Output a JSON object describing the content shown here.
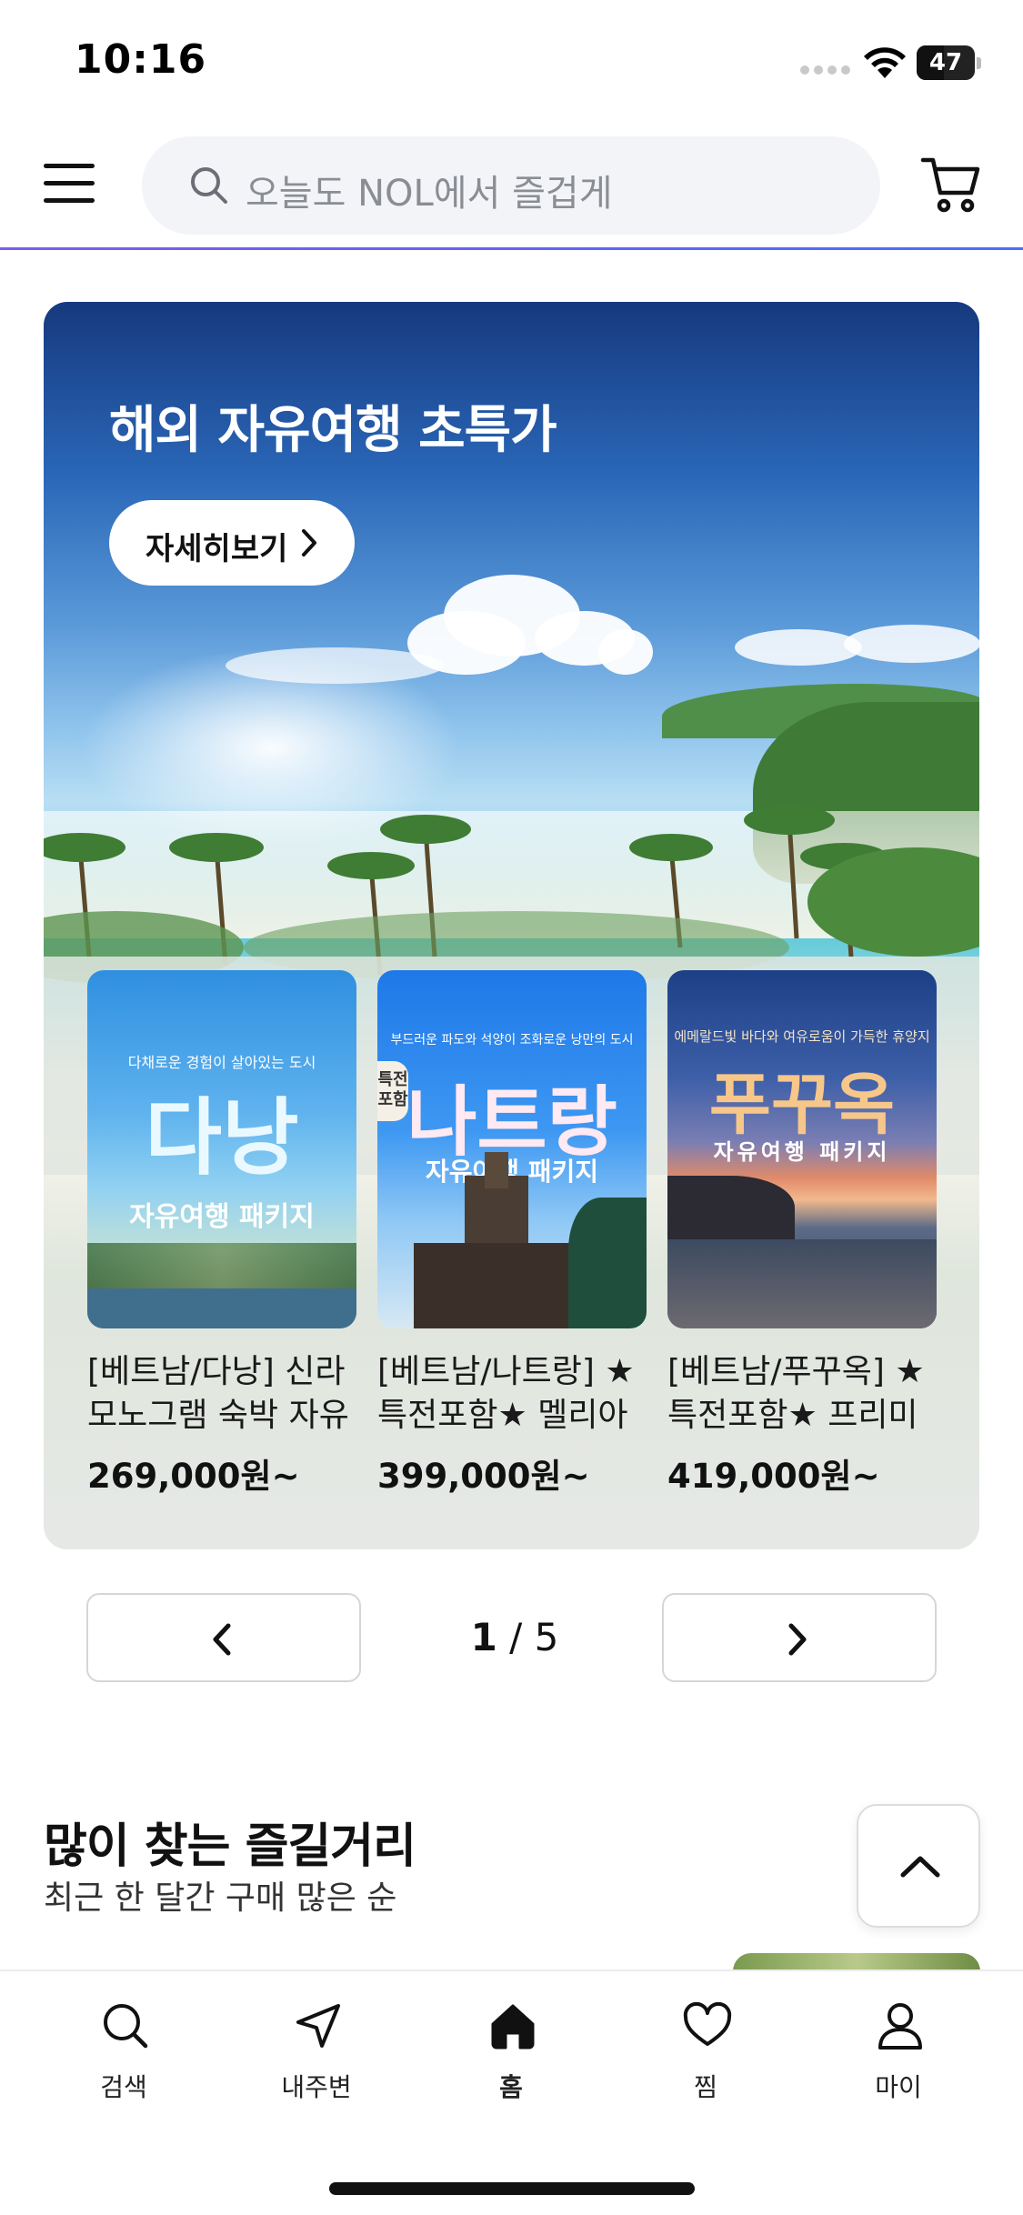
{
  "status_bar": {
    "time": "10:16",
    "battery": "47",
    "battery_percent": 47
  },
  "header": {
    "search_placeholder": "오늘도 NOL에서 즐겁게",
    "accent_color": "#6a5cf3"
  },
  "promo": {
    "title": "해외 자유여행 초특가",
    "detail_button": "자세히보기",
    "products": [
      {
        "image_city": "다낭",
        "image_tagline": "다채로운 경험이 살아있는 도시",
        "image_package": "자유여행 패키지",
        "name": "[베트남/다낭] 신라 모노그램 숙박 자유",
        "price": "269,000원~"
      },
      {
        "image_city": "나트랑",
        "image_tagline": "부드러운 파도와 석양이 조화로운 낭만의 도시",
        "image_badge": "특전 포함",
        "image_package": "자유여행 패키지",
        "name": "[베트남/나트랑] ★특전포함★ 멜리아",
        "price": "399,000원~"
      },
      {
        "image_city": "푸꾸옥",
        "image_tagline": "에메랄드빛 바다와 여유로움이 가득한 휴양지",
        "image_package": "자유여행 패키지",
        "name": "[베트남/푸꾸옥] ★특전포함★ 프리미",
        "price": "419,000원~"
      }
    ]
  },
  "pager": {
    "current": "1",
    "separator": " / ",
    "total": "5"
  },
  "section": {
    "title": "많이 찾는 즐길거리",
    "subtitle": "최근 한 달간 구매 많은 순"
  },
  "bottom_nav": {
    "items": [
      {
        "label": "검색",
        "icon": "search-icon"
      },
      {
        "label": "내주변",
        "icon": "location-arrow-icon"
      },
      {
        "label": "홈",
        "icon": "home-icon",
        "active": true
      },
      {
        "label": "찜",
        "icon": "heart-icon"
      },
      {
        "label": "마이",
        "icon": "person-icon"
      }
    ]
  }
}
